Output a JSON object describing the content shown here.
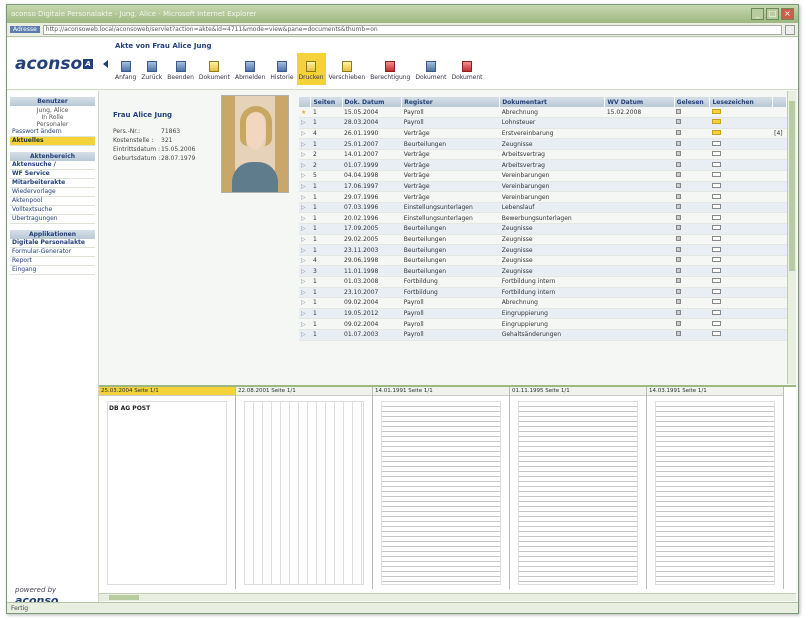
{
  "window": {
    "title": "aconso Digitale Personalakte - Jung, Alice - Microsoft Internet Explorer",
    "address_label": "Adresse",
    "url": "http://aconsoweb.local/aconsoweb/servlet?action=akte&id=4711&mode=view&pane=documents&thumb=on"
  },
  "header": {
    "logo_text": "aconso",
    "logo_mark": "A",
    "akte_title": "Akte von Frau Alice Jung",
    "toolbar": [
      {
        "label": "Anfang",
        "style": "blue"
      },
      {
        "label": "Zurück",
        "style": "blue"
      },
      {
        "label": "Beenden",
        "style": "blue"
      },
      {
        "label": "Dokument",
        "style": "yellow"
      },
      {
        "label": "Abmelden",
        "style": "blue"
      },
      {
        "label": "Historie",
        "style": "blue"
      },
      {
        "label": "Drucken",
        "style": "yellow",
        "selected": true
      },
      {
        "label": "Verschieben",
        "style": "yellow"
      },
      {
        "label": "Berechtigung",
        "style": "red"
      },
      {
        "label": "Dokument",
        "style": "blue"
      },
      {
        "label": "Dokument",
        "style": "red"
      }
    ]
  },
  "sidebar": {
    "sections": [
      {
        "title": "Benutzer",
        "subtitle": "Jung, Alice\nIn Rolle\nPersonaler",
        "items": [
          {
            "label": "Passwort ändern"
          },
          {
            "label": "Aktuelles",
            "selected": true
          }
        ]
      },
      {
        "title": "Aktenbereich",
        "items": [
          {
            "label": "Aktensuche /",
            "bold": true
          },
          {
            "label": "WF Service",
            "bold": true
          },
          {
            "label": "Mitarbeiterakte",
            "bold": true
          },
          {
            "label": "Wiedervorlage"
          },
          {
            "label": "Aktenpool"
          },
          {
            "label": "Volltextsuche"
          },
          {
            "label": "Übertragungen"
          }
        ]
      },
      {
        "title": "Applikationen",
        "items": [
          {
            "label": "Digitale Personalakte",
            "bold": true
          },
          {
            "label": "Formular-Generator"
          },
          {
            "label": "Report"
          },
          {
            "label": "Eingang"
          }
        ]
      }
    ],
    "powered_label": "powered by",
    "powered_logo": "aconso"
  },
  "person": {
    "name": "Frau Alice Jung",
    "fields": [
      {
        "key": "Pers.-Nr.:",
        "value": "71863"
      },
      {
        "key": "Kostenstelle :",
        "value": "321"
      },
      {
        "key": "Eintrittsdatum :",
        "value": "15.05.2006"
      },
      {
        "key": "Geburtsdatum :",
        "value": "28.07.1979"
      }
    ]
  },
  "table": {
    "headers": [
      "",
      "Seiten",
      "Dok. Datum",
      "Register",
      "Dokumentart",
      "WV Datum",
      "Gelesen",
      "Lesezeichen",
      ""
    ],
    "rows": [
      [
        "★",
        "1",
        "15.05.2004",
        "Payroll",
        "Abrechnung",
        "15.02.2008",
        "",
        "",
        ""
      ],
      [
        "▷",
        "1",
        "28.03.2004",
        "Payroll",
        "Lohnsteuer",
        "",
        "",
        "",
        ""
      ],
      [
        "▷",
        "4",
        "26.01.1990",
        "Verträge",
        "Erstvereinbarung",
        "",
        "",
        "",
        "[4]"
      ],
      [
        "▷",
        "1",
        "25.01.2007",
        "Beurteilungen",
        "Zeugnisse",
        "",
        "",
        "",
        ""
      ],
      [
        "▷",
        "2",
        "14.01.2007",
        "Verträge",
        "Arbeitsvertrag",
        "",
        "",
        "",
        ""
      ],
      [
        "▷",
        "2",
        "01.07.1999",
        "Verträge",
        "Arbeitsvertrag",
        "",
        "",
        "",
        ""
      ],
      [
        "▷",
        "5",
        "04.04.1998",
        "Verträge",
        "Vereinbarungen",
        "",
        "",
        "",
        ""
      ],
      [
        "▷",
        "1",
        "17.06.1997",
        "Verträge",
        "Vereinbarungen",
        "",
        "",
        "",
        ""
      ],
      [
        "▷",
        "1",
        "29.07.1996",
        "Verträge",
        "Vereinbarungen",
        "",
        "",
        "",
        ""
      ],
      [
        "▷",
        "1",
        "07.03.1996",
        "Einstellungsunterlagen",
        "Lebenslauf",
        "",
        "",
        "",
        ""
      ],
      [
        "▷",
        "1",
        "20.02.1996",
        "Einstellungsunterlagen",
        "Bewerbungsunterlagen",
        "",
        "",
        "",
        ""
      ],
      [
        "▷",
        "1",
        "17.09.2005",
        "Beurteilungen",
        "Zeugnisse",
        "",
        "",
        "",
        ""
      ],
      [
        "▷",
        "1",
        "29.02.2005",
        "Beurteilungen",
        "Zeugnisse",
        "",
        "",
        "",
        ""
      ],
      [
        "▷",
        "1",
        "23.11.2003",
        "Beurteilungen",
        "Zeugnisse",
        "",
        "",
        "",
        ""
      ],
      [
        "▷",
        "4",
        "29.06.1998",
        "Beurteilungen",
        "Zeugnisse",
        "",
        "",
        "",
        ""
      ],
      [
        "▷",
        "3",
        "11.01.1998",
        "Beurteilungen",
        "Zeugnisse",
        "",
        "",
        "",
        ""
      ],
      [
        "▷",
        "1",
        "01.03.2008",
        "Fortbildung",
        "Fortbildung intern",
        "",
        "",
        "",
        ""
      ],
      [
        "▷",
        "1",
        "23.10.2007",
        "Fortbildung",
        "Fortbildung intern",
        "",
        "",
        "",
        ""
      ],
      [
        "▷",
        "1",
        "09.02.2004",
        "Payroll",
        "Abrechnung",
        "",
        "",
        "",
        ""
      ],
      [
        "▷",
        "1",
        "19.05.2012",
        "Payroll",
        "Eingruppierung",
        "",
        "",
        "",
        ""
      ],
      [
        "▷",
        "1",
        "09.02.2004",
        "Payroll",
        "Eingruppierung",
        "",
        "",
        "",
        ""
      ],
      [
        "▷",
        "1",
        "01.07.2003",
        "Payroll",
        "Gehaltsänderungen",
        "",
        "",
        "",
        ""
      ]
    ]
  },
  "thumbnails": [
    {
      "caption": "25.03.2004 Seite 1/1",
      "doc_heading": "DB AG POST",
      "kind": "first"
    },
    {
      "caption": "22.08.2001 Seite 1/1",
      "kind": "form"
    },
    {
      "caption": "14.01.1991 Seite 1/1",
      "kind": "text"
    },
    {
      "caption": "01.11.1995 Seite 1/1",
      "kind": "text"
    },
    {
      "caption": "14.03.1991 Seite 1/1",
      "kind": "text"
    }
  ],
  "status_text": "Fertig"
}
